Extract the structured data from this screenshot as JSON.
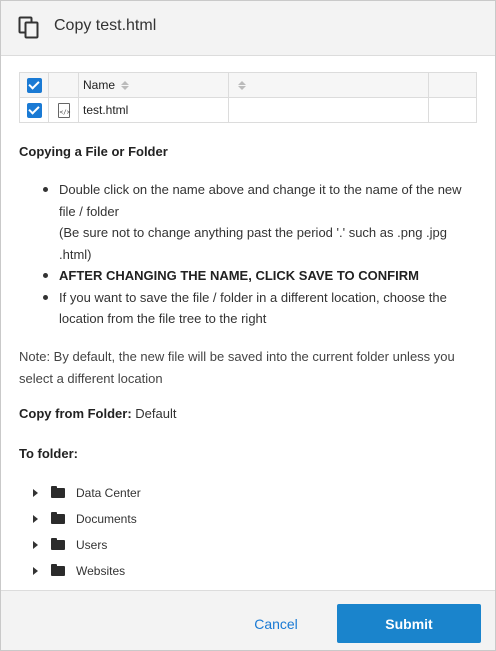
{
  "header": {
    "title": "Copy test.html",
    "icon": "copy-icon"
  },
  "table": {
    "header": {
      "name_label": "Name"
    },
    "rows": [
      {
        "name": "test.html",
        "icon": "html-file-icon"
      }
    ]
  },
  "instructions": {
    "title": "Copying a File or Folder",
    "items": [
      {
        "line1": "Double click on the name above and change it to the name of the new file / folder",
        "line2": "(Be sure not to change anything past the period '.' such as .png .jpg .html)"
      },
      {
        "text": "AFTER CHANGING THE NAME, CLICK SAVE TO CONFIRM"
      },
      {
        "text": "If you want to save the file / folder in a different location, choose the location from the file tree to the right"
      }
    ]
  },
  "note": "Note: By default, the new file will be saved into the current folder unless you select a different location",
  "copy_from": {
    "label": "Copy from Folder:",
    "value": "Default"
  },
  "to_folder": {
    "label": "To folder:"
  },
  "folders": [
    {
      "label": "Data Center"
    },
    {
      "label": "Documents"
    },
    {
      "label": "Users"
    },
    {
      "label": "Websites"
    }
  ],
  "footer": {
    "cancel_label": "Cancel",
    "submit_label": "Submit"
  },
  "colors": {
    "accent": "#1a84cc",
    "link": "#1a7ad4",
    "header_bg": "#f3f3f3"
  }
}
